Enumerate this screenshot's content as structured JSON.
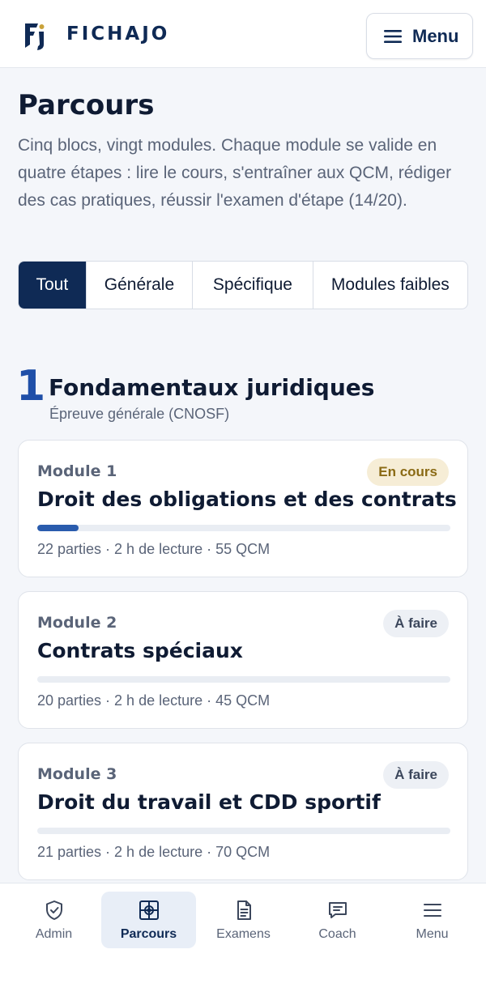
{
  "header": {
    "brand": "FICHAJO",
    "menu_label": "Menu",
    "logo_icon": "fichajo-logo-icon",
    "menu_icon": "hamburger-icon"
  },
  "page": {
    "title": "Parcours",
    "description": "Cinq blocs, vingt modules. Chaque module se valide en quatre étapes : lire le cours, s'entraîner aux QCM, rédiger des cas pratiques, réussir l'examen d'étape (14/20)."
  },
  "filters": [
    {
      "label": "Tout",
      "active": true
    },
    {
      "label": "Générale",
      "active": false
    },
    {
      "label": "Spécifique",
      "active": false
    },
    {
      "label": "Modules faibles",
      "active": false
    }
  ],
  "bloc": {
    "number": "1",
    "title": "Fondamentaux juridiques",
    "subtitle": "Épreuve générale (CNOSF)"
  },
  "modules": [
    {
      "module": "Module 1",
      "status": "En cours",
      "title": "Droit des obligations et des contrats",
      "progress": 0.1,
      "meta": "22 parties · 2 h de lecture · 55 QCM"
    },
    {
      "module": "Module 2",
      "status": "À faire",
      "title": "Contrats spéciaux",
      "progress": 0,
      "meta": "20 parties · 2 h de lecture · 45 QCM"
    },
    {
      "module": "Module 3",
      "status": "À faire",
      "title": "Droit du travail et CDD sportif",
      "progress": 0,
      "meta": "21 parties · 2 h de lecture · 70 QCM"
    }
  ],
  "bottom_nav": [
    {
      "label": "Admin",
      "icon": "shield-check-icon",
      "active": false
    },
    {
      "label": "Parcours",
      "icon": "target-icon",
      "active": true
    },
    {
      "label": "Examens",
      "icon": "document-icon",
      "active": false
    },
    {
      "label": "Coach",
      "icon": "chat-icon",
      "active": false
    },
    {
      "label": "Menu",
      "icon": "hamburger-icon",
      "active": false
    }
  ],
  "colors": {
    "brand": "#0f2a55",
    "accent": "#2a5cad",
    "status_current_bg": "#f6edd6",
    "status_current_text": "#8a6a14",
    "status_todo_bg": "#edf0f5"
  }
}
